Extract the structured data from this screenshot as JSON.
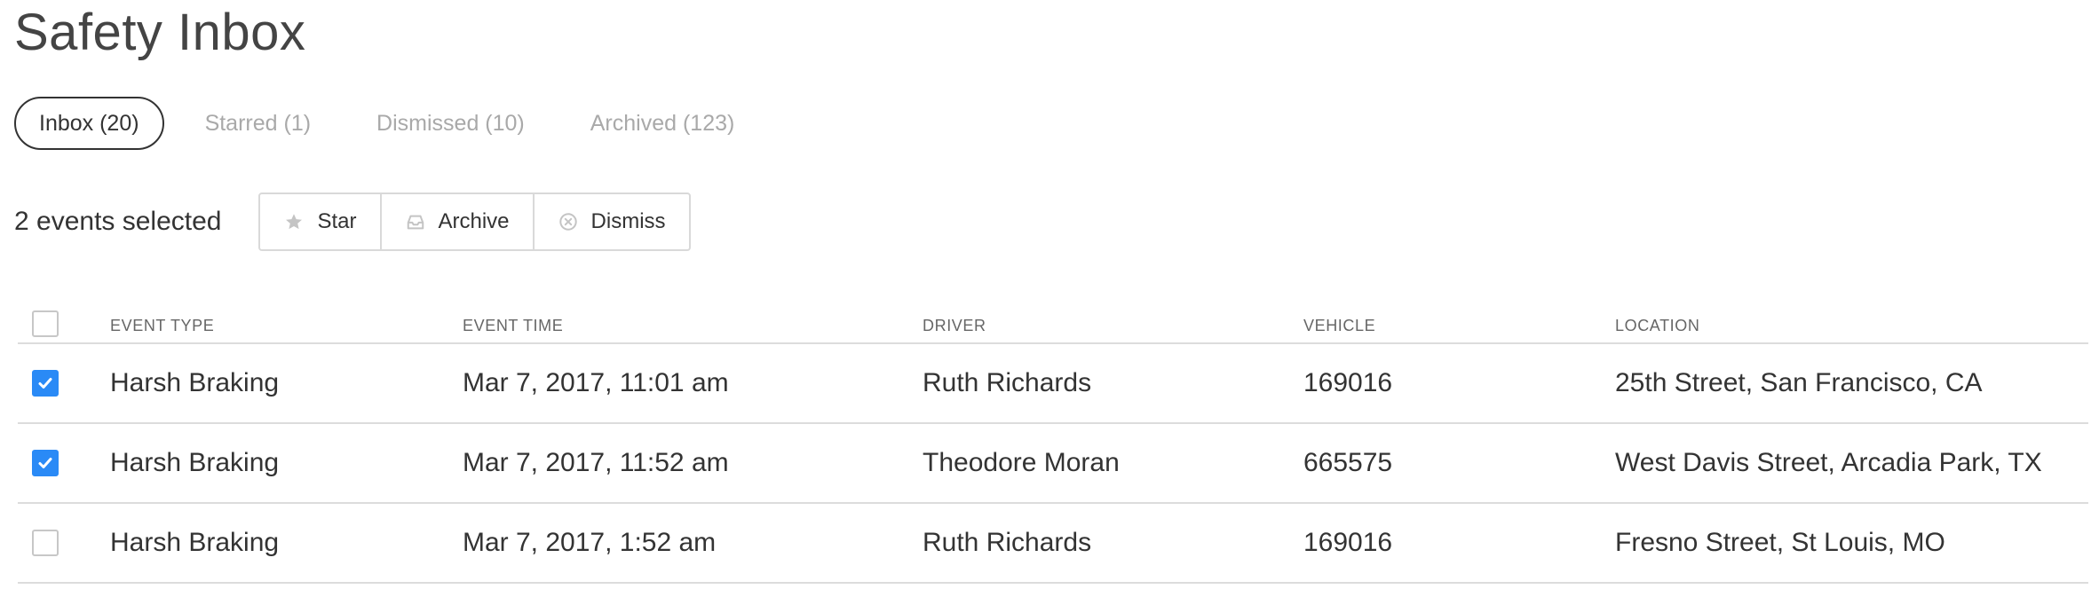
{
  "page": {
    "title": "Safety Inbox"
  },
  "tabs": [
    {
      "label": "Inbox (20)",
      "active": true
    },
    {
      "label": "Starred (1)",
      "active": false
    },
    {
      "label": "Dismissed (10)",
      "active": false
    },
    {
      "label": "Archived (123)",
      "active": false
    }
  ],
  "selection": {
    "count_text": "2 events selected",
    "actions": [
      {
        "label": "Star",
        "icon": "star-icon"
      },
      {
        "label": "Archive",
        "icon": "archive-icon"
      },
      {
        "label": "Dismiss",
        "icon": "dismiss-icon"
      }
    ]
  },
  "table": {
    "columns": [
      "EVENT TYPE",
      "EVENT TIME",
      "DRIVER",
      "VEHICLE",
      "LOCATION"
    ],
    "header_checked": false,
    "rows": [
      {
        "checked": true,
        "event_type": "Harsh Braking",
        "event_time": "Mar 7, 2017, 11:01 am",
        "driver": "Ruth Richards",
        "vehicle": "169016",
        "location": "25th Street, San Francisco, CA"
      },
      {
        "checked": true,
        "event_type": "Harsh Braking",
        "event_time": "Mar 7, 2017, 11:52 am",
        "driver": "Theodore Moran",
        "vehicle": "665575",
        "location": "West Davis Street, Arcadia Park, TX"
      },
      {
        "checked": false,
        "event_type": "Harsh Braking",
        "event_time": "Mar 7, 2017, 1:52 am",
        "driver": "Ruth Richards",
        "vehicle": "169016",
        "location": "Fresno Street, St Louis, MO"
      }
    ]
  },
  "colors": {
    "accent": "#2a8af6",
    "text": "#333333",
    "muted": "#a9a9a9",
    "border": "#dcdcdc"
  }
}
